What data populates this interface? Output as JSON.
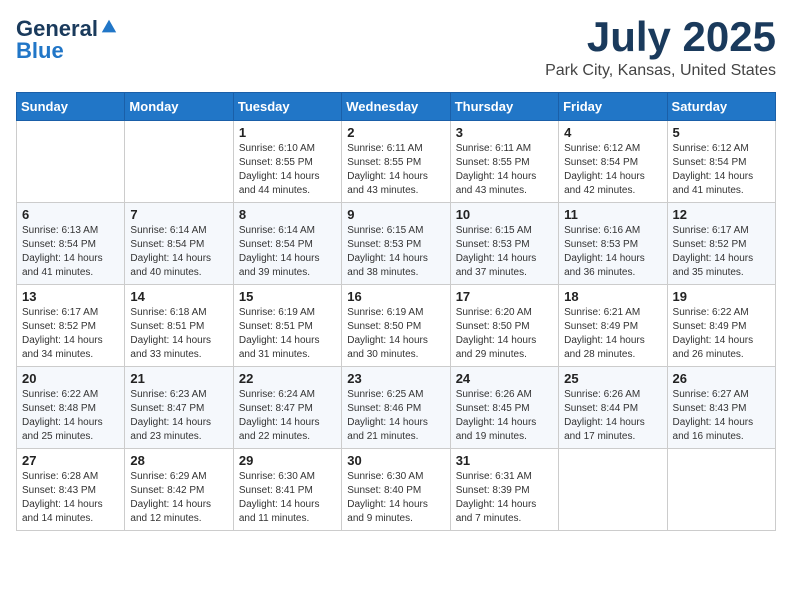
{
  "header": {
    "logo_general": "General",
    "logo_blue": "Blue",
    "title": "July 2025",
    "location": "Park City, Kansas, United States"
  },
  "days_of_week": [
    "Sunday",
    "Monday",
    "Tuesday",
    "Wednesday",
    "Thursday",
    "Friday",
    "Saturday"
  ],
  "weeks": [
    [
      {
        "day": "",
        "info": ""
      },
      {
        "day": "",
        "info": ""
      },
      {
        "day": "1",
        "info": "Sunrise: 6:10 AM\nSunset: 8:55 PM\nDaylight: 14 hours and 44 minutes."
      },
      {
        "day": "2",
        "info": "Sunrise: 6:11 AM\nSunset: 8:55 PM\nDaylight: 14 hours and 43 minutes."
      },
      {
        "day": "3",
        "info": "Sunrise: 6:11 AM\nSunset: 8:55 PM\nDaylight: 14 hours and 43 minutes."
      },
      {
        "day": "4",
        "info": "Sunrise: 6:12 AM\nSunset: 8:54 PM\nDaylight: 14 hours and 42 minutes."
      },
      {
        "day": "5",
        "info": "Sunrise: 6:12 AM\nSunset: 8:54 PM\nDaylight: 14 hours and 41 minutes."
      }
    ],
    [
      {
        "day": "6",
        "info": "Sunrise: 6:13 AM\nSunset: 8:54 PM\nDaylight: 14 hours and 41 minutes."
      },
      {
        "day": "7",
        "info": "Sunrise: 6:14 AM\nSunset: 8:54 PM\nDaylight: 14 hours and 40 minutes."
      },
      {
        "day": "8",
        "info": "Sunrise: 6:14 AM\nSunset: 8:54 PM\nDaylight: 14 hours and 39 minutes."
      },
      {
        "day": "9",
        "info": "Sunrise: 6:15 AM\nSunset: 8:53 PM\nDaylight: 14 hours and 38 minutes."
      },
      {
        "day": "10",
        "info": "Sunrise: 6:15 AM\nSunset: 8:53 PM\nDaylight: 14 hours and 37 minutes."
      },
      {
        "day": "11",
        "info": "Sunrise: 6:16 AM\nSunset: 8:53 PM\nDaylight: 14 hours and 36 minutes."
      },
      {
        "day": "12",
        "info": "Sunrise: 6:17 AM\nSunset: 8:52 PM\nDaylight: 14 hours and 35 minutes."
      }
    ],
    [
      {
        "day": "13",
        "info": "Sunrise: 6:17 AM\nSunset: 8:52 PM\nDaylight: 14 hours and 34 minutes."
      },
      {
        "day": "14",
        "info": "Sunrise: 6:18 AM\nSunset: 8:51 PM\nDaylight: 14 hours and 33 minutes."
      },
      {
        "day": "15",
        "info": "Sunrise: 6:19 AM\nSunset: 8:51 PM\nDaylight: 14 hours and 31 minutes."
      },
      {
        "day": "16",
        "info": "Sunrise: 6:19 AM\nSunset: 8:50 PM\nDaylight: 14 hours and 30 minutes."
      },
      {
        "day": "17",
        "info": "Sunrise: 6:20 AM\nSunset: 8:50 PM\nDaylight: 14 hours and 29 minutes."
      },
      {
        "day": "18",
        "info": "Sunrise: 6:21 AM\nSunset: 8:49 PM\nDaylight: 14 hours and 28 minutes."
      },
      {
        "day": "19",
        "info": "Sunrise: 6:22 AM\nSunset: 8:49 PM\nDaylight: 14 hours and 26 minutes."
      }
    ],
    [
      {
        "day": "20",
        "info": "Sunrise: 6:22 AM\nSunset: 8:48 PM\nDaylight: 14 hours and 25 minutes."
      },
      {
        "day": "21",
        "info": "Sunrise: 6:23 AM\nSunset: 8:47 PM\nDaylight: 14 hours and 23 minutes."
      },
      {
        "day": "22",
        "info": "Sunrise: 6:24 AM\nSunset: 8:47 PM\nDaylight: 14 hours and 22 minutes."
      },
      {
        "day": "23",
        "info": "Sunrise: 6:25 AM\nSunset: 8:46 PM\nDaylight: 14 hours and 21 minutes."
      },
      {
        "day": "24",
        "info": "Sunrise: 6:26 AM\nSunset: 8:45 PM\nDaylight: 14 hours and 19 minutes."
      },
      {
        "day": "25",
        "info": "Sunrise: 6:26 AM\nSunset: 8:44 PM\nDaylight: 14 hours and 17 minutes."
      },
      {
        "day": "26",
        "info": "Sunrise: 6:27 AM\nSunset: 8:43 PM\nDaylight: 14 hours and 16 minutes."
      }
    ],
    [
      {
        "day": "27",
        "info": "Sunrise: 6:28 AM\nSunset: 8:43 PM\nDaylight: 14 hours and 14 minutes."
      },
      {
        "day": "28",
        "info": "Sunrise: 6:29 AM\nSunset: 8:42 PM\nDaylight: 14 hours and 12 minutes."
      },
      {
        "day": "29",
        "info": "Sunrise: 6:30 AM\nSunset: 8:41 PM\nDaylight: 14 hours and 11 minutes."
      },
      {
        "day": "30",
        "info": "Sunrise: 6:30 AM\nSunset: 8:40 PM\nDaylight: 14 hours and 9 minutes."
      },
      {
        "day": "31",
        "info": "Sunrise: 6:31 AM\nSunset: 8:39 PM\nDaylight: 14 hours and 7 minutes."
      },
      {
        "day": "",
        "info": ""
      },
      {
        "day": "",
        "info": ""
      }
    ]
  ]
}
